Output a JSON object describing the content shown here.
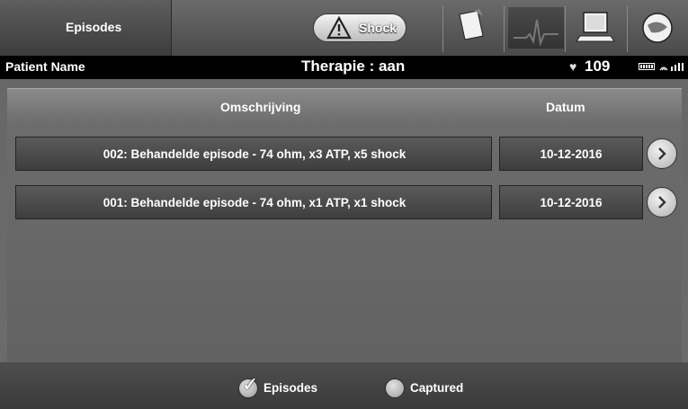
{
  "toolbar": {
    "episodes_tab_label": "Episodes",
    "shock_label": "Shock",
    "buttons": [
      {
        "name": "reports-icon"
      },
      {
        "name": "ecg-icon"
      },
      {
        "name": "programmer-icon"
      },
      {
        "name": "settings-icon"
      }
    ]
  },
  "status": {
    "patient_name_label": "Patient Name",
    "therapy": "Therapie : aan",
    "heart_rate": "109"
  },
  "table": {
    "columns": [
      "Omschrijving",
      "Datum"
    ],
    "rows": [
      {
        "description": "002: Behandelde episode - 74 ohm, x3 ATP, x5 shock",
        "date": "10-12-2016"
      },
      {
        "description": "001: Behandelde episode - 74 ohm, x1 ATP, x1 shock",
        "date": "10-12-2016"
      }
    ]
  },
  "filters": {
    "episodes_label": "Episodes",
    "episodes_checked": true,
    "captured_label": "Captured",
    "captured_checked": false
  },
  "colors": {
    "background": "#6e6e6e",
    "statusbar": "#000000",
    "text": "#ffffff"
  }
}
